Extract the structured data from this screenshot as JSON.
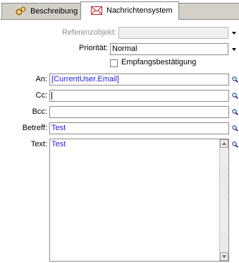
{
  "tabs": [
    {
      "label": "Beschreibung",
      "icon": "gears-icon",
      "active": false
    },
    {
      "label": "Nachrichtensystem",
      "icon": "envelope-icon",
      "active": true
    }
  ],
  "form": {
    "reference_object": {
      "label": "Referenzobjekt:",
      "value": "",
      "disabled": true
    },
    "priority": {
      "label": "Priorität:",
      "value": "Normal"
    },
    "receipt": {
      "label": "Empfangsbestätigung",
      "checked": false
    },
    "to": {
      "label": "An:",
      "value": "[CurrentUser.Email]"
    },
    "cc": {
      "label": "Cc:",
      "value": ""
    },
    "bcc": {
      "label": "Bcc:",
      "value": ""
    },
    "subject": {
      "label": "Betreff:",
      "value": "Test"
    },
    "text": {
      "label": "Text:",
      "value": "Test"
    }
  },
  "colors": {
    "value_text": "#1d1de0",
    "tab_inactive_bg": "#d4d0c8",
    "disabled_text": "#8f8f8f"
  }
}
